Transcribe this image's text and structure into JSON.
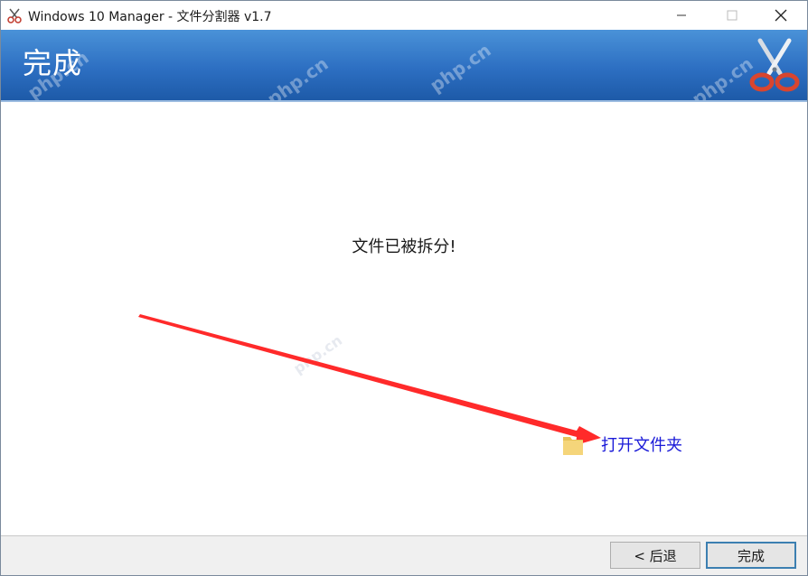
{
  "window": {
    "title": "Windows 10 Manager - 文件分割器 v1.7",
    "controls": {
      "minimize": "minimize-icon",
      "maximize": "maximize-icon",
      "close": "close-icon"
    }
  },
  "banner": {
    "title": "完成",
    "watermark": "php.cn",
    "icon": "scissors-icon"
  },
  "content": {
    "message": "文件已被拆分!",
    "open_folder_label": "打开文件夹",
    "open_folder_icon": "folder-icon",
    "annotation": "red-arrow",
    "annotation_color": "#ff2a2a"
  },
  "footer": {
    "back_label": "< 后退",
    "finish_label": "完成"
  },
  "colors": {
    "banner": "#2d6fc2",
    "link": "#1a1ad8",
    "arrow": "#ff2a2a"
  }
}
